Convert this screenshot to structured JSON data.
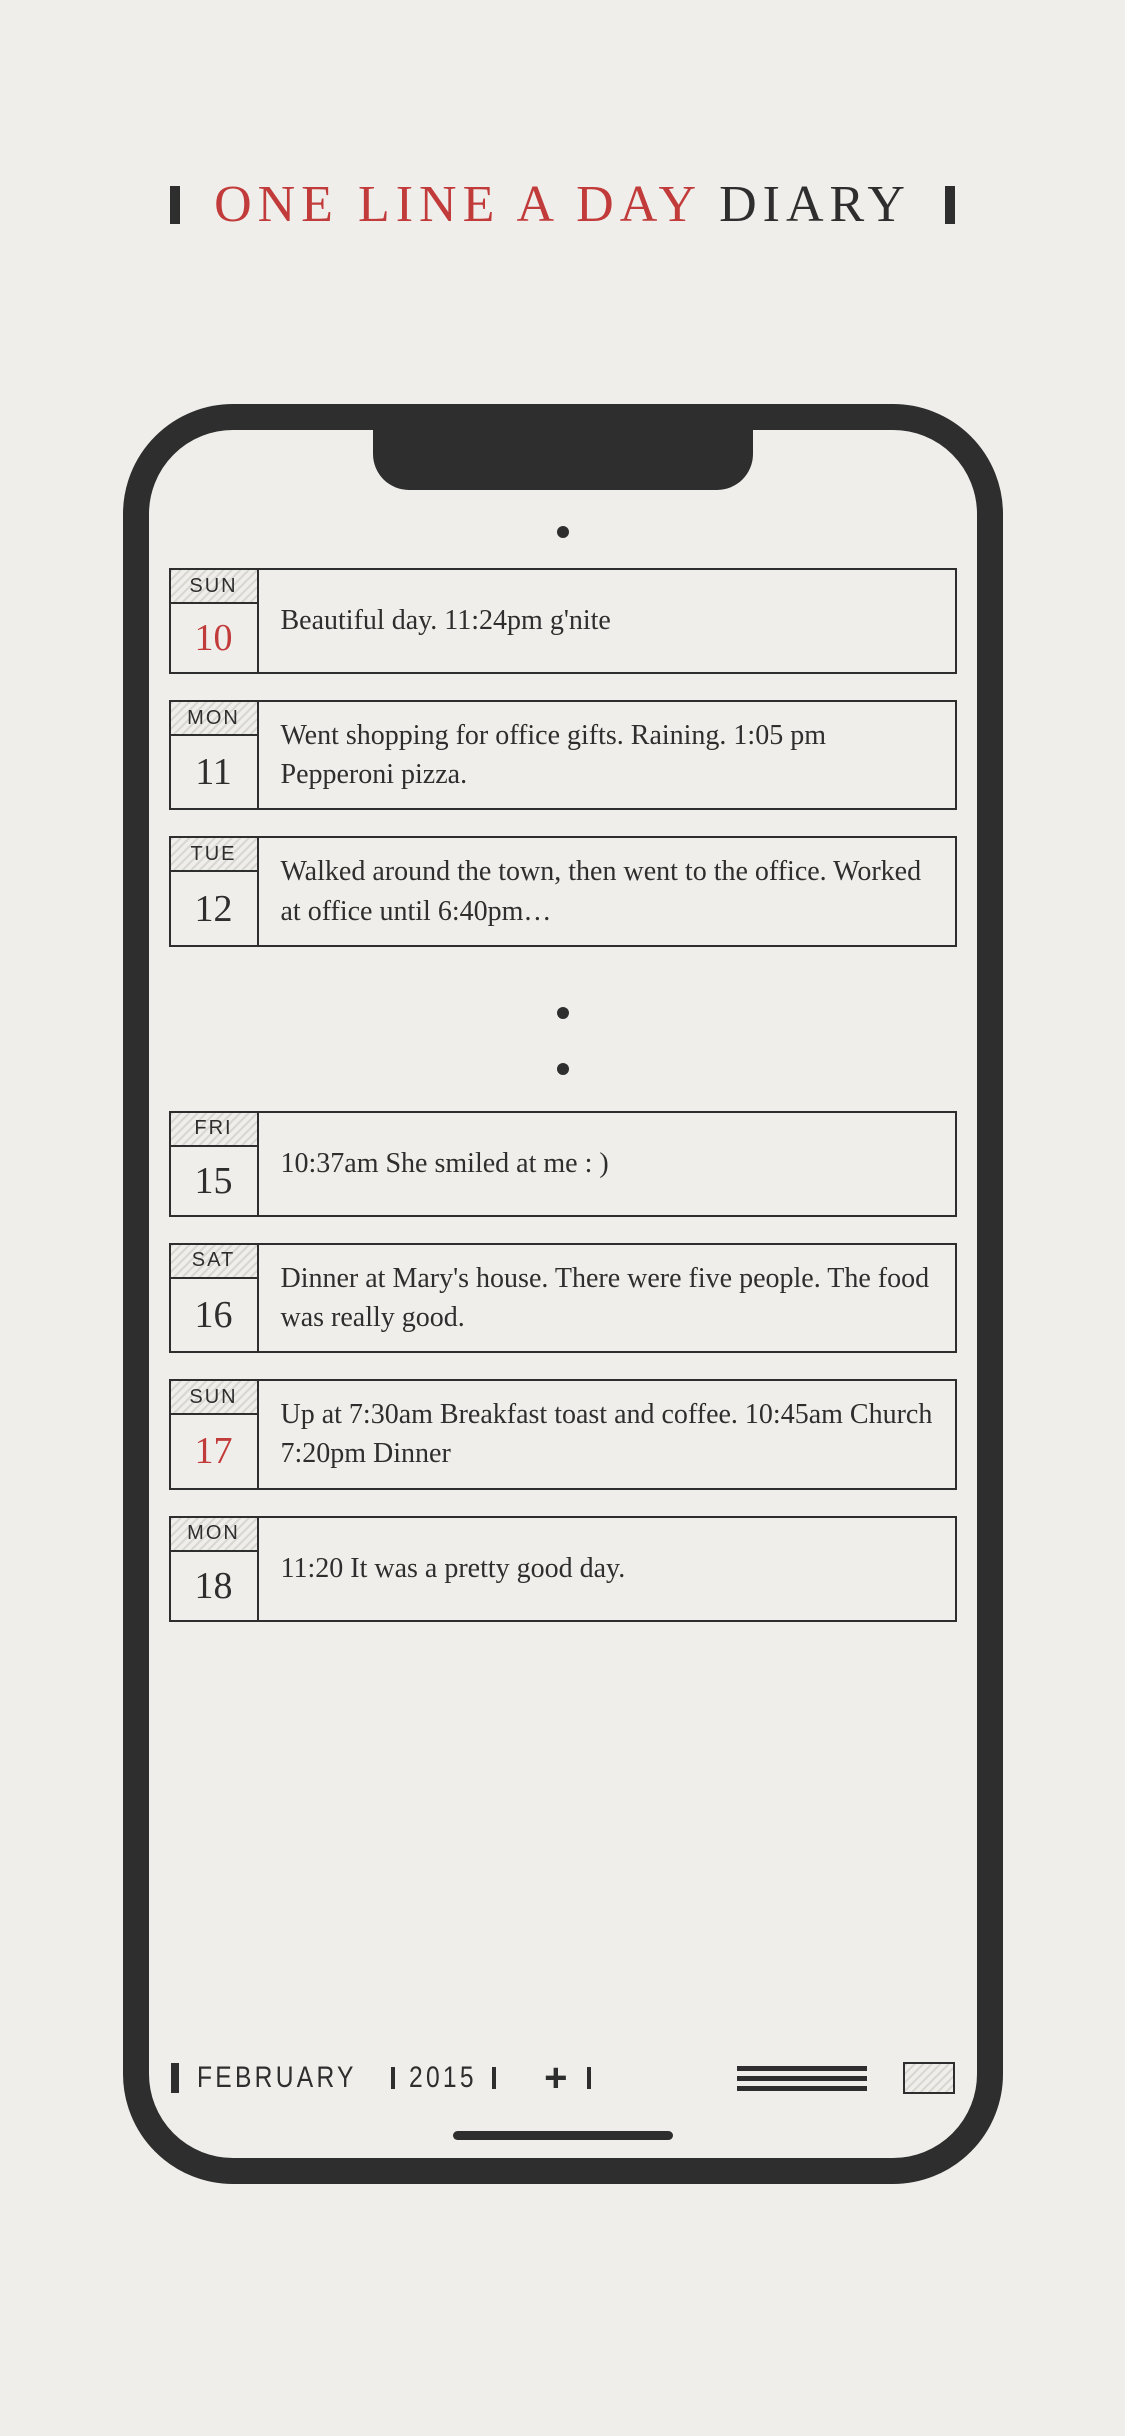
{
  "title": {
    "part1": "ONE LINE A DAY",
    "part2": "DIARY"
  },
  "entries": [
    {
      "weekday": "SUN",
      "day": "10",
      "sunday": true,
      "text": "Beautiful day. 11:24pm g'nite"
    },
    {
      "weekday": "MON",
      "day": "11",
      "sunday": false,
      "text": "Went shopping for office gifts. Raining. 1:05 pm Pepperoni pizza."
    },
    {
      "weekday": "TUE",
      "day": "12",
      "sunday": false,
      "text": "Walked around the town, then went to the office. Worked at office until 6:40pm…"
    },
    {
      "weekday": "FRI",
      "day": "15",
      "sunday": false,
      "text": "10:37am She smiled at me : )"
    },
    {
      "weekday": "SAT",
      "day": "16",
      "sunday": false,
      "text": "Dinner at Mary's house. There were five people. The food was really good."
    },
    {
      "weekday": "SUN",
      "day": "17",
      "sunday": true,
      "text": "Up at 7:30am Breakfast toast and coffee. 10:45am Church   7:20pm Dinner"
    },
    {
      "weekday": "MON",
      "day": "18",
      "sunday": false,
      "text": "11:20 It was a pretty good day."
    }
  ],
  "toolbar": {
    "month": "FEBRUARY",
    "year": "2015"
  }
}
